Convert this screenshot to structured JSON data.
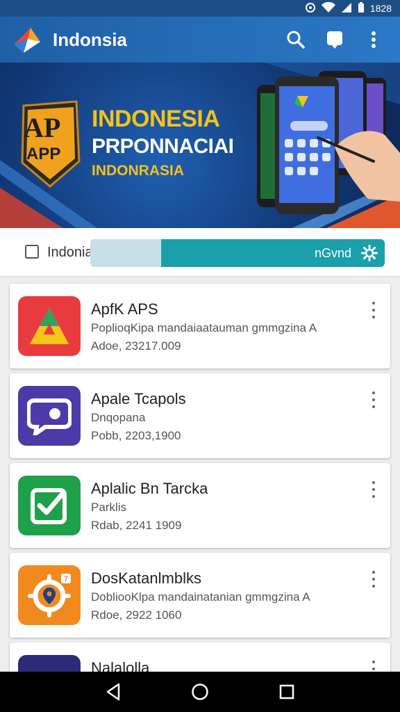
{
  "status_bar": {
    "time": "1828",
    "icons": [
      "alarm-icon",
      "wifi-icon",
      "signal-icon",
      "battery-icon"
    ]
  },
  "app_bar": {
    "title": "Indonsia",
    "actions": [
      "search-icon",
      "notification-icon",
      "more-vert-icon"
    ],
    "color": "#2566ad"
  },
  "banner": {
    "badge_text_top": "AP",
    "badge_text_bottom": "APP",
    "line1": "INDONESIA",
    "line2": "PRPONNACIAI",
    "line3": "INDONRASIA"
  },
  "filter": {
    "label": "Indoniauais",
    "bar_text": "nGvnd",
    "fill_fraction": 0.24,
    "accent": "#1aa0aa"
  },
  "apps": [
    {
      "title": "ApfK APS",
      "desc": "PoplioqKipa mandaiaatauman gmmgzina A",
      "meta": "Adoe, 23217.009",
      "icon": "triangle-a-icon",
      "color": "#e83b3f"
    },
    {
      "title": "Apale Tcapols",
      "desc": "Dnqopana",
      "meta": "Pobb, 2203,1900",
      "icon": "chat-bubble-icon",
      "color": "#4b3aa8"
    },
    {
      "title": "Aplalic Bn Tarcka",
      "desc": "Parklis",
      "meta": "Rdab, 2241 1909",
      "icon": "checkbox-icon",
      "color": "#1fa04a"
    },
    {
      "title": "DosKatanlmblks",
      "desc": "DobliooKlpa mandainatanian gmmgzina A",
      "meta": "Rdoe, 2922 1060",
      "icon": "location-gear-icon",
      "color": "#f08a1e"
    },
    {
      "title": "Nalalolla",
      "desc": "",
      "meta": "",
      "icon": "partial-app-icon",
      "color": "#2e2a7a"
    }
  ],
  "nav_bar": [
    "back-icon",
    "home-icon",
    "recents-icon"
  ]
}
